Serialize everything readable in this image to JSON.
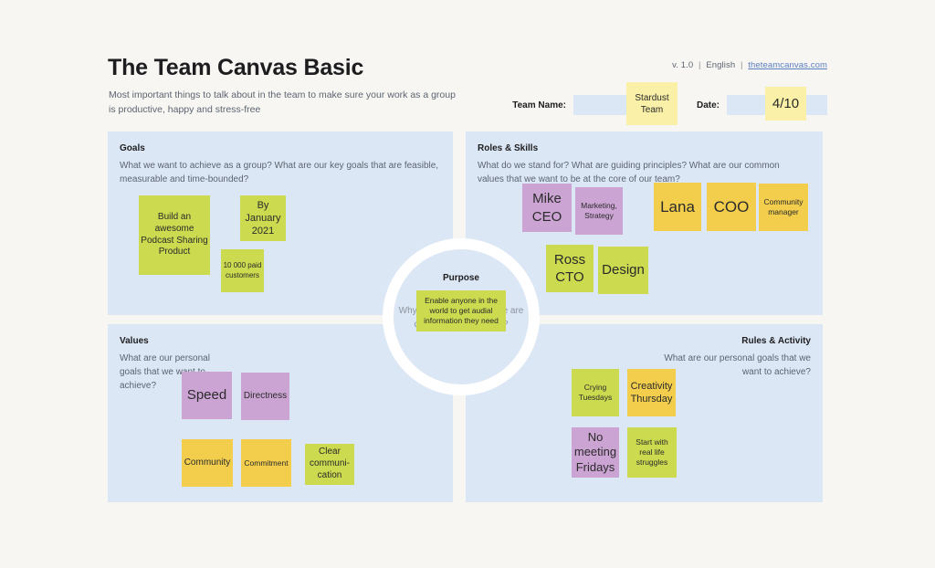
{
  "header": {
    "title": "The Team Canvas Basic",
    "subtitle": "Most important things to talk about in the team to make sure your work as a group is productive, happy and stress-free",
    "version": "v. 1.0",
    "language": "English",
    "website": "theteamcanvas.com",
    "team_name_label": "Team Name:",
    "team_name_value": "Stardust Team",
    "date_label": "Date:",
    "date_value": "4/10"
  },
  "colors": {
    "page_background": "#f7f6f3",
    "panel_background": "#dce7f5",
    "note_green": "#cbda4e",
    "note_purple": "#cba4d4",
    "note_yellow": "#f2ce4c",
    "note_pale_yellow": "#faf0a8",
    "link": "#5a7fc0",
    "body_text": "#5b6470",
    "heading_text": "#1d1d1f"
  },
  "panels": {
    "goals": {
      "title": "Goals",
      "description": "What we want to achieve as a group? What are our key goals that are feasible, measurable and time-bounded?",
      "notes": [
        {
          "text": "Build an awesome Podcast Sharing Product",
          "color": "green"
        },
        {
          "text": "By January 2021",
          "color": "green"
        },
        {
          "text": "10 000 paid customers",
          "color": "green"
        }
      ]
    },
    "roles": {
      "title": "Roles & Skills",
      "description": "What do we stand for? What are guiding principles? What are our common values that we want to be at the core of our team?",
      "notes": [
        {
          "text": "Mike CEO",
          "color": "purple"
        },
        {
          "text": "Marketing, Strategy",
          "color": "purple"
        },
        {
          "text": "Lana",
          "color": "yellow"
        },
        {
          "text": "COO",
          "color": "yellow"
        },
        {
          "text": "Community manager",
          "color": "yellow"
        },
        {
          "text": "Ross CTO",
          "color": "green"
        },
        {
          "text": "Design",
          "color": "green"
        }
      ]
    },
    "values": {
      "title": "Values",
      "description": "What are our personal goals that we want to achieve?",
      "notes": [
        {
          "text": "Speed",
          "color": "purple"
        },
        {
          "text": "Directness",
          "color": "purple"
        },
        {
          "text": "Community",
          "color": "yellow"
        },
        {
          "text": "Commitment",
          "color": "yellow"
        },
        {
          "text": "Clear communi-cation",
          "color": "green"
        }
      ]
    },
    "rules": {
      "title": "Rules & Activity",
      "description": "What are our personal goals that we want to achieve?",
      "notes": [
        {
          "text": "Crying Tuesdays",
          "color": "green"
        },
        {
          "text": "Creativity Thursday",
          "color": "yellow"
        },
        {
          "text": "No meeting Fridays",
          "color": "purple"
        },
        {
          "text": "Start with real life struggles",
          "color": "green"
        }
      ]
    },
    "purpose": {
      "title": "Purpose",
      "description": "Why are we doing what we are doing in the first place?",
      "notes": [
        {
          "text": "Enable anyone in the world to get audial information they need",
          "color": "green"
        }
      ]
    }
  }
}
